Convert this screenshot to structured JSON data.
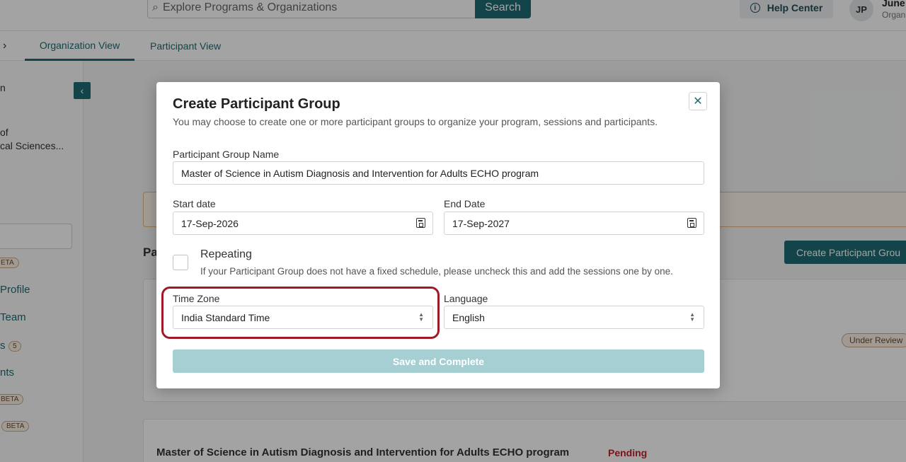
{
  "header": {
    "search_placeholder": "Explore Programs & Organizations",
    "search_button": "Search",
    "help_center": "Help Center",
    "avatar_initials": "JP",
    "user_name": "June",
    "user_role": "Organ"
  },
  "tabs": [
    {
      "label": "Organization View",
      "active": true
    },
    {
      "label": "Participant View",
      "active": false
    }
  ],
  "sidebar": {
    "org_line": "n",
    "org_name_1": "of",
    "org_name_2": "cal Sciences...",
    "beta_1": "ETA",
    "profile": "Profile",
    "team": "Team",
    "s_text": "s",
    "s_count": "5",
    "nts": "nts",
    "beta_2": "BETA",
    "beta_3": "BETA"
  },
  "content": {
    "section_prefix": "Pa",
    "create_group_button": "Create Participant Grou",
    "under_review": "Under Review",
    "program_title": "Master of Science in Autism Diagnosis and Intervention for Adults ECHO program",
    "status": "Pending"
  },
  "modal": {
    "title": "Create Participant Group",
    "subtitle": "You may choose to create one or more participant groups to organize your program, sessions and participants.",
    "group_name_label": "Participant Group Name",
    "group_name_value": "Master of Science in Autism Diagnosis and Intervention for Adults ECHO program",
    "start_date_label": "Start date",
    "start_date_value": "17-Sep-2026",
    "end_date_label": "End Date",
    "end_date_value": "17-Sep-2027",
    "repeating_label": "Repeating",
    "repeating_checked": false,
    "repeating_help": "If your Participant Group does not have a fixed schedule, please uncheck this and add the sessions one by one.",
    "timezone_label": "Time Zone",
    "timezone_value": "India Standard Time",
    "language_label": "Language",
    "language_value": "English",
    "save_button": "Save and Complete"
  },
  "colors": {
    "brand": "#1e6b72",
    "highlight": "#a01a26",
    "save_disabled": "#a6cfd3",
    "pending": "#c0212b"
  }
}
